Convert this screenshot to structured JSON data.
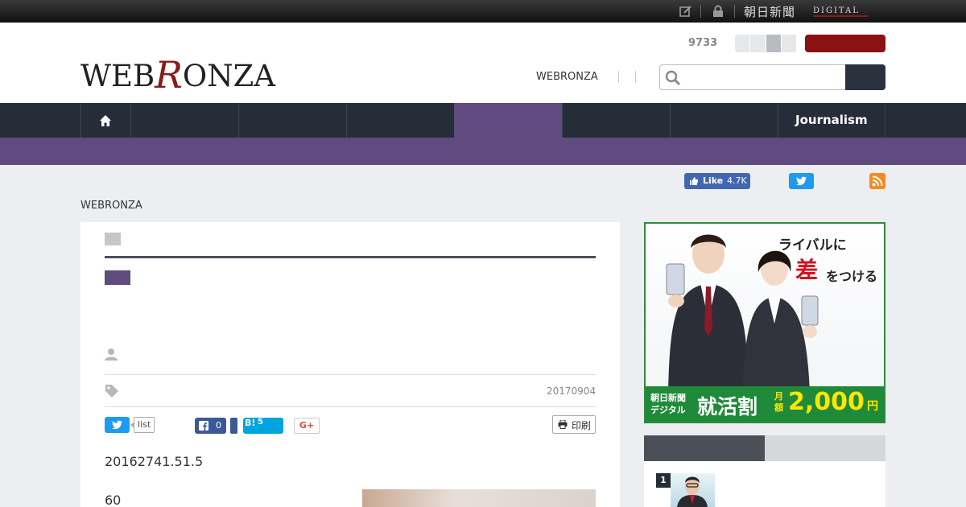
{
  "topbar": {
    "brand": "朝日新聞",
    "digital": "DIGITAL"
  },
  "header": {
    "logo_part1": "WEB",
    "logo_part2": "R",
    "logo_part3": "ONZA",
    "count": "9733",
    "nav_link": "WEBRONZA",
    "search_placeholder": ""
  },
  "nav": {
    "journalism": "Journalism"
  },
  "social": {
    "fb_like": "Like",
    "fb_like_count": "4.7K"
  },
  "breadcrumb": "WEBRONZA",
  "article": {
    "date": "20170904",
    "tweet_count": "list",
    "fb_share_count": "0",
    "hatena_label": "B!",
    "hatena_count": "5",
    "gplus_label": "G+",
    "print_label": "印刷",
    "lead": "20162741.51.5",
    "body": "60"
  },
  "ad": {
    "line1": "ライバルに",
    "line2": "差",
    "line3": "をつける",
    "band_small": "朝日新聞\nデジタル",
    "band_main": "就活割",
    "band_month": "月額",
    "band_price": "2,000",
    "band_yen": "円"
  },
  "ranking": {
    "first_no": "1"
  },
  "colors": {
    "nav_dark": "#252e38",
    "accent_purple": "#5f4b7e",
    "login_red": "#8b1212",
    "ad_green": "#1f8a3a"
  }
}
